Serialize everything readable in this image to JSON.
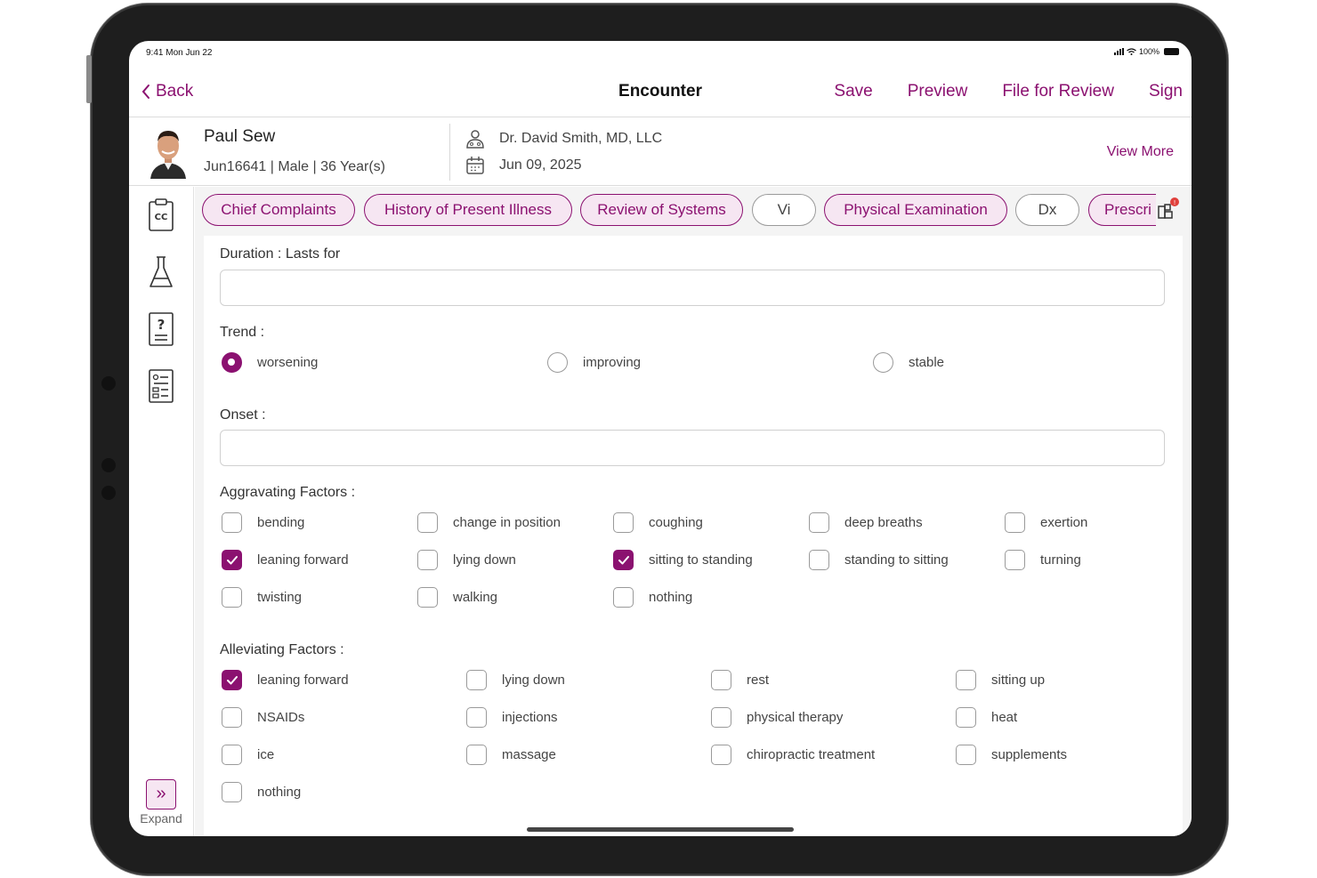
{
  "status_bar": {
    "time": "9:41  Mon Jun 22",
    "battery": "100%"
  },
  "nav": {
    "back_label": "Back",
    "title": "Encounter",
    "actions": [
      "Save",
      "Preview",
      "File for Review",
      "Sign"
    ]
  },
  "patient": {
    "name": "Paul Sew",
    "meta": "Jun16641  |  Male  |  36 Year(s)",
    "doctor": "Dr. David Smith, MD, LLC",
    "date": "Jun 09, 2025",
    "view_more": "View More"
  },
  "sidebar": {
    "items": [
      "cc-clipboard-icon",
      "lab-flask-icon",
      "question-doc-icon",
      "report-list-icon"
    ],
    "expand_label": "Expand"
  },
  "tabs": [
    {
      "label": "Chief Complaints",
      "style": "filled"
    },
    {
      "label": "History of Present Illness",
      "style": "filled"
    },
    {
      "label": "Review of Systems",
      "style": "filled"
    },
    {
      "label": "Vi",
      "style": "plain"
    },
    {
      "label": "Physical Examination",
      "style": "filled"
    },
    {
      "label": "Dx",
      "style": "plain"
    },
    {
      "label": "Prescri",
      "style": "filled"
    }
  ],
  "form": {
    "duration_label": "Duration : Lasts for",
    "duration_value": "",
    "trend_label": "Trend :",
    "trend_options": [
      {
        "label": "worsening",
        "selected": true
      },
      {
        "label": "improving",
        "selected": false
      },
      {
        "label": "stable",
        "selected": false
      }
    ],
    "onset_label": "Onset :",
    "onset_value": "",
    "aggravating_label": "Aggravating Factors :",
    "aggravating": [
      {
        "label": "bending",
        "checked": false
      },
      {
        "label": "change in position",
        "checked": false
      },
      {
        "label": "coughing",
        "checked": false
      },
      {
        "label": "deep breaths",
        "checked": false
      },
      {
        "label": "exertion",
        "checked": false
      },
      {
        "label": "leaning forward",
        "checked": true
      },
      {
        "label": "lying down",
        "checked": false
      },
      {
        "label": "sitting to standing",
        "checked": true
      },
      {
        "label": "standing to sitting",
        "checked": false
      },
      {
        "label": "turning",
        "checked": false
      },
      {
        "label": "twisting",
        "checked": false
      },
      {
        "label": "walking",
        "checked": false
      },
      {
        "label": "nothing",
        "checked": false
      }
    ],
    "alleviating_label": "Alleviating Factors :",
    "alleviating": [
      {
        "label": "leaning forward",
        "checked": true
      },
      {
        "label": "lying down",
        "checked": false
      },
      {
        "label": "rest",
        "checked": false
      },
      {
        "label": "sitting up",
        "checked": false
      },
      {
        "label": "NSAIDs",
        "checked": false
      },
      {
        "label": "injections",
        "checked": false
      },
      {
        "label": "physical therapy",
        "checked": false
      },
      {
        "label": "heat",
        "checked": false
      },
      {
        "label": "ice",
        "checked": false
      },
      {
        "label": "massage",
        "checked": false
      },
      {
        "label": "chiropractic treatment",
        "checked": false
      },
      {
        "label": "supplements",
        "checked": false
      },
      {
        "label": "nothing",
        "checked": false
      }
    ]
  },
  "colors": {
    "accent": "#8b1170",
    "accent_light": "#f6e6f2",
    "border": "#d0d0d0"
  }
}
